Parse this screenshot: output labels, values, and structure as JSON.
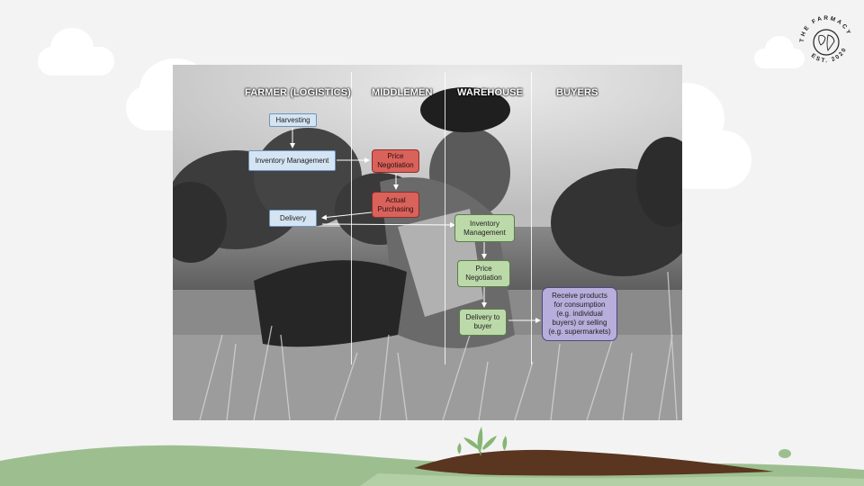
{
  "columns": {
    "farmer": "FARMER (LOGISTICS)",
    "middlemen": "MIDDLEMEN",
    "warehouse": "WAREHOUSE",
    "buyers": "BUYERS"
  },
  "farmer": {
    "harvesting": "Harvesting",
    "inventory": "Inventory Management",
    "delivery": "Delivery"
  },
  "middlemen": {
    "price": "Price Negotiation",
    "purchasing": "Actual Purchasing"
  },
  "warehouse": {
    "inventory": "Inventory Management",
    "price": "Price Negotiation",
    "delivery": "Delivery to buyer"
  },
  "buyers": {
    "receive": "Receive products for consumption (e.g. individual buyers) or selling (e.g. supermarkets)"
  },
  "logo": {
    "top_text": "THE FARMACY",
    "bottom_text": "EST. 2020"
  },
  "colors": {
    "farmer_box": "#d4e4f3",
    "middlemen_box": "#d9625b",
    "warehouse_box": "#bcd9a9",
    "buyers_box": "#b7aedb",
    "hill_green": "#9dbf90",
    "soil_brown": "#5a3520"
  }
}
